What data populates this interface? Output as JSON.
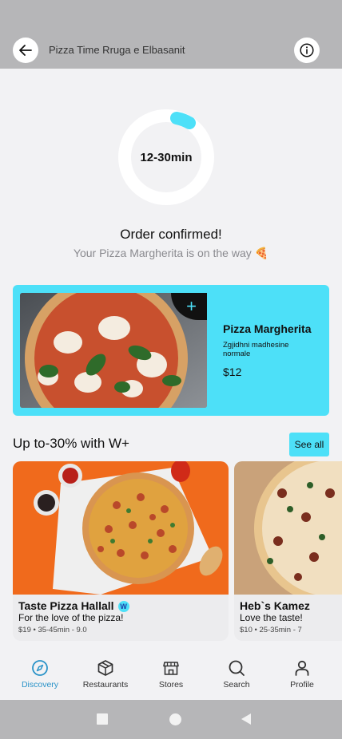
{
  "header": {
    "title": "Pizza Time Rruga e Elbasanit"
  },
  "order": {
    "eta": "12-30min",
    "status": "Order confirmed!",
    "message": "Your Pizza Margherita is on the way 🍕"
  },
  "item": {
    "name": "Pizza Margherita",
    "description": "Zgjidhni madhesine normale",
    "price": "$12",
    "add_label": "+"
  },
  "promo": {
    "title": "Up to-30% with W+",
    "see_all": "See all",
    "cards": [
      {
        "name": "Taste Pizza Hallall",
        "tagline": "For the love of the pizza!",
        "meta": "$19 • 35-45min - 9.0",
        "badge": "W"
      },
      {
        "name": "Heb`s Kamez",
        "tagline": "Love the taste!",
        "meta": "$10 • 25-35min - 7"
      }
    ]
  },
  "nav": {
    "items": [
      {
        "label": "Discovery",
        "icon": "compass-icon",
        "active": true
      },
      {
        "label": "Restaurants",
        "icon": "box-icon"
      },
      {
        "label": "Stores",
        "icon": "store-icon"
      },
      {
        "label": "Search",
        "icon": "search-icon"
      },
      {
        "label": "Profile",
        "icon": "person-icon"
      }
    ]
  },
  "colors": {
    "accent": "#4de0f8",
    "active_nav": "#2a93c8"
  }
}
